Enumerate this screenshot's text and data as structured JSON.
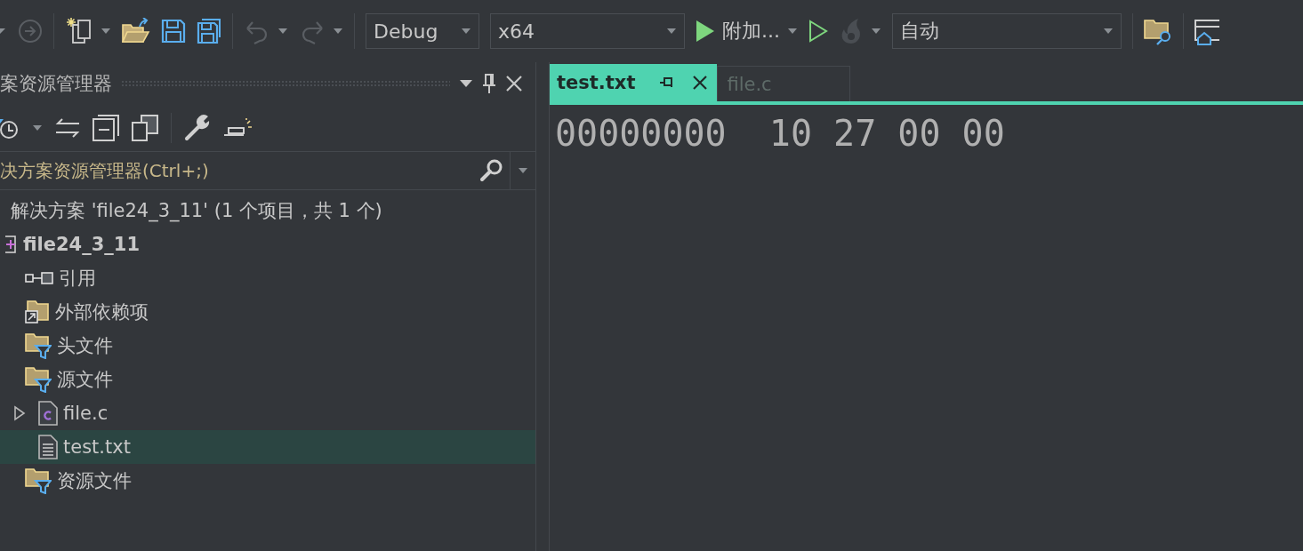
{
  "toolbar": {
    "configuration": "Debug",
    "platform": "x64",
    "start_label": "附加...",
    "target": "自动"
  },
  "solution_explorer": {
    "title": "案资源管理器",
    "search": {
      "placeholder": "决方案资源管理器(Ctrl+;)"
    },
    "tree": [
      {
        "label": "解决方案 'file24_3_11' (1 个项目，共 1 个)",
        "selected": false,
        "children": [
          {
            "label": "file24_3_11",
            "kind": "project",
            "selected": false,
            "children": [
              {
                "label": "引用",
                "kind": "references",
                "selected": false
              },
              {
                "label": "外部依赖项",
                "kind": "external",
                "selected": false
              },
              {
                "label": "头文件",
                "kind": "filter",
                "selected": false
              },
              {
                "label": "源文件",
                "kind": "filter",
                "selected": false,
                "children": [
                  {
                    "label": "file.c",
                    "kind": "c-file",
                    "selected": false,
                    "expanded": false
                  },
                  {
                    "label": "test.txt",
                    "kind": "text-file",
                    "selected": true
                  }
                ]
              },
              {
                "label": "资源文件",
                "kind": "filter",
                "selected": false
              }
            ]
          }
        ]
      }
    ]
  },
  "editor": {
    "tabs": [
      {
        "label": "test.txt",
        "selected": true
      },
      {
        "label": "file.c",
        "selected": false
      }
    ],
    "lines": [
      "00000000  10 27 00 00"
    ]
  }
}
